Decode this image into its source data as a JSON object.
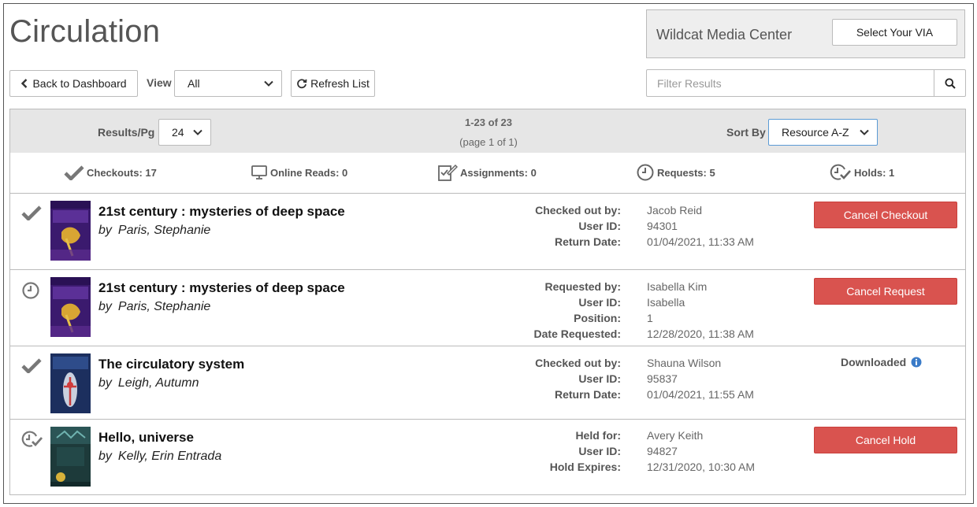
{
  "header": {
    "title": "Circulation",
    "via_name": "Wildcat Media Center",
    "select_via_label": "Select Your VIA"
  },
  "toolbar": {
    "back_label": "Back to Dashboard",
    "view_label": "View",
    "view_value": "All",
    "refresh_label": "Refresh List",
    "filter_placeholder": "Filter Results"
  },
  "results_bar": {
    "per_page_label": "Results/Pg",
    "per_page_value": "24",
    "range": "1-23 of 23",
    "page": "(page 1 of 1)",
    "sort_label": "Sort By",
    "sort_value": "Resource A-Z"
  },
  "stats": {
    "checkouts": "Checkouts: 17",
    "online_reads": "Online Reads: 0",
    "assignments": "Assignments: 0",
    "requests": "Requests: 5",
    "holds": "Holds: 1"
  },
  "items": [
    {
      "title": "21st century : mysteries of deep space",
      "by": "by",
      "author": "Paris, Stephanie",
      "fields": [
        {
          "label": "Checked out by:",
          "value": "Jacob Reid"
        },
        {
          "label": "User ID:",
          "value": "94301"
        },
        {
          "label": "Return Date:",
          "value": "01/04/2021, 11:33 AM"
        }
      ],
      "action": "Cancel Checkout"
    },
    {
      "title": "21st century : mysteries of deep space",
      "by": "by",
      "author": "Paris, Stephanie",
      "fields": [
        {
          "label": "Requested by:",
          "value": "Isabella Kim"
        },
        {
          "label": "User ID:",
          "value": "Isabella"
        },
        {
          "label": "Position:",
          "value": "1"
        },
        {
          "label": "Date Requested:",
          "value": "12/28/2020, 11:38 AM"
        }
      ],
      "action": "Cancel Request"
    },
    {
      "title": "The circulatory system",
      "by": "by",
      "author": "Leigh, Autumn",
      "fields": [
        {
          "label": "Checked out by:",
          "value": "Shauna Wilson"
        },
        {
          "label": "User ID:",
          "value": "95837"
        },
        {
          "label": "Return Date:",
          "value": "01/04/2021, 11:55 AM"
        }
      ],
      "status": "Downloaded"
    },
    {
      "title": "Hello, universe",
      "by": "by",
      "author": "Kelly, Erin Entrada",
      "fields": [
        {
          "label": "Held for:",
          "value": "Avery Keith"
        },
        {
          "label": "User ID:",
          "value": "94827"
        },
        {
          "label": "Hold Expires:",
          "value": "12/31/2020, 10:30 AM"
        }
      ],
      "action": "Cancel Hold"
    }
  ],
  "colors": {
    "danger": "#d9534f",
    "info": "#3a7bc8",
    "bar_bg": "#e6e6e6",
    "sort_border": "#5b9bd5"
  },
  "icons": [
    "chevron-left-icon",
    "chevron-down-icon",
    "refresh-icon",
    "search-icon",
    "check-icon",
    "monitor-icon",
    "assignment-icon",
    "clock-icon",
    "hold-icon",
    "info-icon"
  ]
}
